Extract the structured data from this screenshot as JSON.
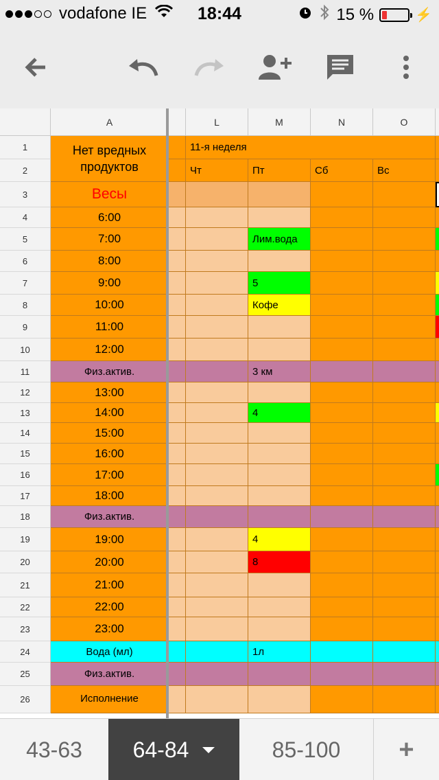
{
  "status": {
    "carrier": "vodafone IE",
    "time": "18:44",
    "battery": "15 %",
    "signal_bars_filled": 3,
    "signal_bars_total": 5
  },
  "toolbar": {
    "back": "back-arrow-icon",
    "undo": "undo-icon",
    "redo": "redo-icon",
    "share": "add-person-icon",
    "comment": "comment-icon",
    "menu": "more-vert-icon"
  },
  "columns": [
    "A",
    "L",
    "M",
    "N",
    "O"
  ],
  "title": "Нет вредных продуктов",
  "week_label": "11-я неделя",
  "days": [
    "Чт",
    "Пт",
    "Сб",
    "Вс"
  ],
  "weights_label": "Весы",
  "rows": [
    {
      "n": "1"
    },
    {
      "n": "2"
    },
    {
      "n": "3"
    },
    {
      "n": "4",
      "a": "6:00"
    },
    {
      "n": "5",
      "a": "7:00",
      "m": "Лим.вода"
    },
    {
      "n": "6",
      "a": "8:00"
    },
    {
      "n": "7",
      "a": "9:00",
      "m": "5"
    },
    {
      "n": "8",
      "a": "10:00",
      "m": "Кофе"
    },
    {
      "n": "9",
      "a": "11:00"
    },
    {
      "n": "10",
      "a": "12:00"
    },
    {
      "n": "11",
      "a": "Физ.актив.",
      "m": "3 км"
    },
    {
      "n": "12",
      "a": "13:00"
    },
    {
      "n": "13",
      "a": "14:00",
      "m": "4"
    },
    {
      "n": "14",
      "a": "15:00"
    },
    {
      "n": "15",
      "a": "16:00"
    },
    {
      "n": "16",
      "a": "17:00"
    },
    {
      "n": "17",
      "a": "18:00"
    },
    {
      "n": "18",
      "a": "Физ.актив."
    },
    {
      "n": "19",
      "a": "19:00",
      "m": "4"
    },
    {
      "n": "20",
      "a": "20:00",
      "m": "8"
    },
    {
      "n": "21",
      "a": "21:00"
    },
    {
      "n": "22",
      "a": "22:00"
    },
    {
      "n": "23",
      "a": "23:00"
    },
    {
      "n": "24",
      "a": "Вода (мл)",
      "m": "1л"
    },
    {
      "n": "25",
      "a": "Физ.актив."
    },
    {
      "n": "26",
      "a": "Исполнение"
    }
  ],
  "colors": {
    "orange": "#ff9900",
    "peach": "#f9cb9c",
    "peach_dark": "#f6b26b",
    "purple": "#c27ba0",
    "cyan": "#00ffff",
    "green": "#00ff00",
    "yellow": "#ffff00",
    "magenta": "#ff00ff",
    "red": "#ff0000",
    "weights_text": "#ff0000"
  },
  "tabs": [
    "43-63",
    "64-84",
    "85-100",
    "+"
  ],
  "active_tab": "64-84"
}
